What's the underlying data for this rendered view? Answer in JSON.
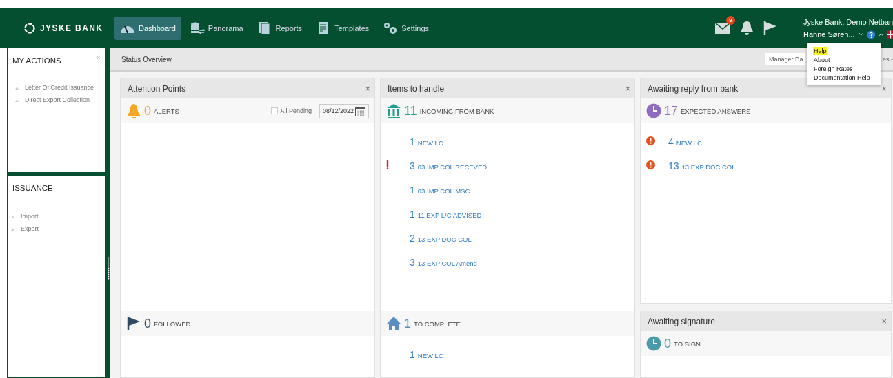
{
  "header": {
    "logo": "JYSKE BANK",
    "nav": [
      {
        "label": "Dashboard",
        "selected": true
      },
      {
        "label": "Panorama",
        "selected": false
      },
      {
        "label": "Reports",
        "selected": false
      },
      {
        "label": "Templates",
        "selected": false
      },
      {
        "label": "Settings",
        "selected": false
      }
    ],
    "mail_badge": "9",
    "company": "Jyske Bank, Demo Netban",
    "user": "Hanne Søren..."
  },
  "help_menu": [
    {
      "label": "Help",
      "selected": true
    },
    {
      "label": "About",
      "selected": false
    },
    {
      "label": "Foreign Rates",
      "selected": false
    },
    {
      "label": "Documentation Help",
      "selected": false
    }
  ],
  "sidebar": [
    {
      "title": "MY ACTIONS",
      "collapse": "«",
      "items": [
        "Letter Of Credit Issuance",
        "Direct Export Collection"
      ]
    },
    {
      "title": "ISSUANCE",
      "items": [
        "Import",
        "Export"
      ]
    }
  ],
  "toolbar": {
    "title": "Status Overview",
    "view_select": "Manager Da",
    "second_select": "es"
  },
  "columns": [
    {
      "panels": [
        {
          "title": "Attention Points",
          "close": "×",
          "sections": [
            {
              "kind": "bell",
              "color": "#f5a623",
              "count": "0",
              "label": "ALERTS",
              "filter": {
                "label": "All Pending",
                "checked": false,
                "date": "08/12/2022"
              }
            },
            {
              "kind": "flag",
              "color": "#2f4a63",
              "count": "0",
              "label": "FOLLOWED"
            }
          ]
        }
      ]
    },
    {
      "panels": [
        {
          "title": "Items to handle",
          "close": "×",
          "sections": [
            {
              "kind": "bank",
              "color": "#1fa08e",
              "count": "11",
              "label": "INCOMING FROM BANK",
              "items": [
                {
                  "count": "1",
                  "label": "NEW LC",
                  "alert": false
                },
                {
                  "count": "3",
                  "label": "03 IMP COL RECEVED",
                  "alert": true
                },
                {
                  "count": "1",
                  "label": "03 IMP COL MSC",
                  "alert": false
                },
                {
                  "count": "1",
                  "label": "11 EXP L/C ADVISED",
                  "alert": false
                },
                {
                  "count": "2",
                  "label": "13 EXP DOC COL",
                  "alert": false
                },
                {
                  "count": "3",
                  "label": "13 EXP COL Amend",
                  "alert": false
                }
              ]
            },
            {
              "kind": "house",
              "color": "#5a8dc0",
              "count": "1",
              "label": "TO COMPLETE",
              "items": [
                {
                  "count": "1",
                  "label": "NEW LC",
                  "alert": false
                }
              ]
            }
          ]
        }
      ]
    },
    {
      "panels": [
        {
          "title": "Awaiting reply from bank",
          "close": "×",
          "sections": [
            {
              "kind": "clock",
              "color": "#8e6cbf",
              "count": "17",
              "label": "EXPECTED ANSWERS",
              "items": [
                {
                  "count": "4",
                  "label": "NEW LC",
                  "alert": true
                },
                {
                  "count": "13",
                  "label": "13 EXP DOC COL",
                  "alert": true
                }
              ]
            }
          ]
        },
        {
          "title": "Awaiting signature",
          "close": "×",
          "sections": [
            {
              "kind": "clock",
              "color": "#4a9aaa",
              "count": "0",
              "label": "TO SIGN"
            }
          ]
        }
      ]
    }
  ]
}
